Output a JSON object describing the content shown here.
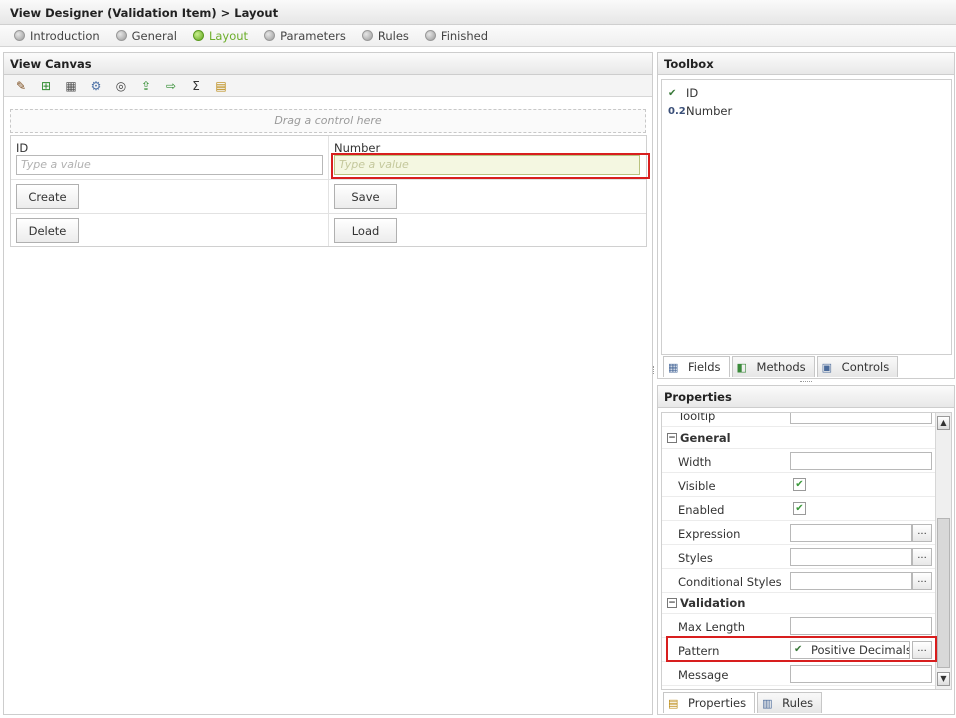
{
  "title": "View Designer (Validation Item) > Layout",
  "steps": [
    {
      "label": "Introduction"
    },
    {
      "label": "General"
    },
    {
      "label": "Layout",
      "active": true
    },
    {
      "label": "Parameters"
    },
    {
      "label": "Rules"
    },
    {
      "label": "Finished"
    }
  ],
  "canvas": {
    "header": "View Canvas",
    "toolbar_icons": [
      "wand-icon",
      "add-table-icon",
      "edit-table-icon",
      "gear-icon",
      "binoculars-icon",
      "import-icon",
      "export-icon",
      "sigma-icon",
      "notes-icon"
    ],
    "drop_zone": "Drag a control here",
    "fields": {
      "id_label": "ID",
      "id_placeholder": "Type a value",
      "number_label": "Number",
      "number_placeholder": "Type a value"
    },
    "buttons": {
      "create": "Create",
      "save": "Save",
      "delete": "Delete",
      "load": "Load"
    }
  },
  "toolbox": {
    "header": "Toolbox",
    "items": [
      {
        "icon": "id-field-icon",
        "label": "ID"
      },
      {
        "icon_text": "0.2",
        "label": "Number"
      }
    ],
    "tabs": [
      "Fields",
      "Methods",
      "Controls"
    ]
  },
  "properties": {
    "header": "Properties",
    "partial_row": "Tooltip",
    "general_section": "General",
    "width": "Width",
    "visible": "Visible",
    "enabled": "Enabled",
    "expression": "Expression",
    "styles": "Styles",
    "conditional_styles": "Conditional Styles",
    "validation_section": "Validation",
    "max_length": "Max Length",
    "pattern": "Pattern",
    "pattern_value": "Positive Decimals",
    "message": "Message",
    "ellipsis": "...",
    "tabs": [
      "Properties",
      "Rules"
    ]
  }
}
